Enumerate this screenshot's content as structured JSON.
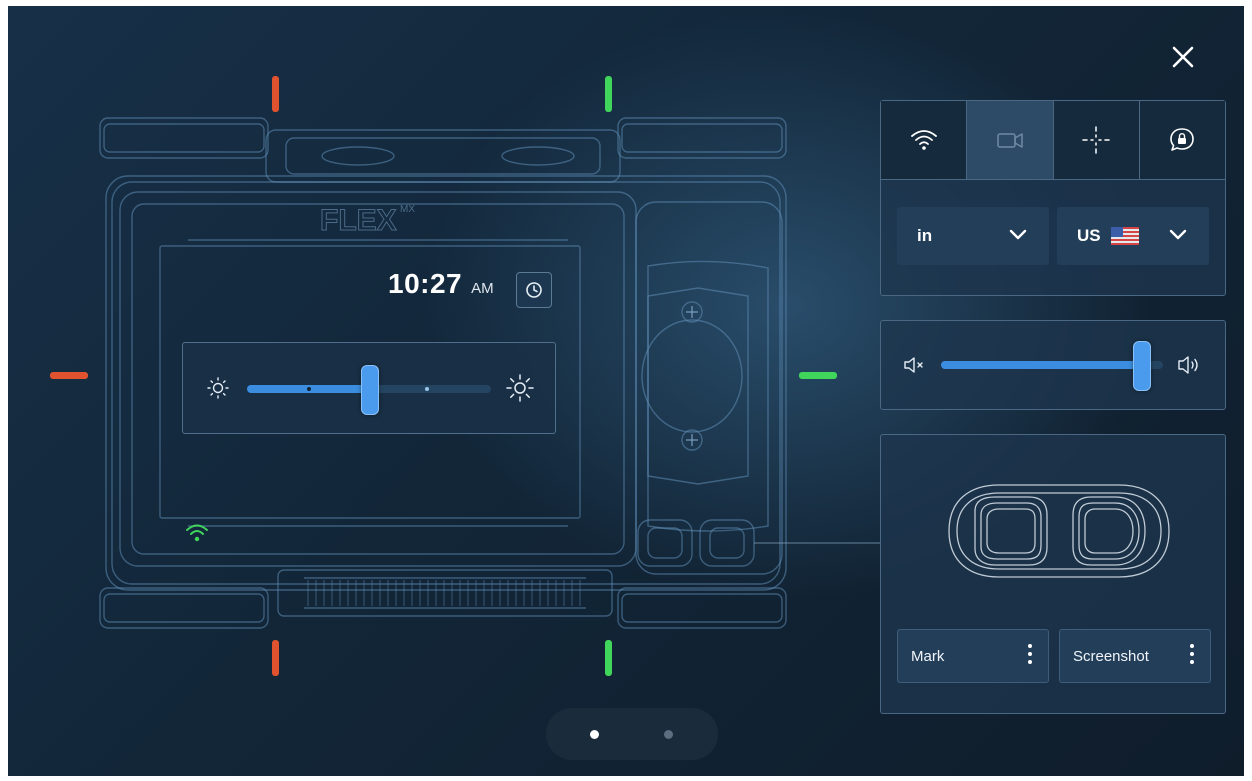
{
  "device": {
    "brand_logo": "FLEX",
    "brand_logo_suffix": "MX",
    "clock": {
      "time": "10:27",
      "ampm": "AM"
    },
    "brightness": {
      "level": 0.5
    },
    "wifi_status": "connected"
  },
  "markers": {
    "red": "#e0532e",
    "green": "#3fd65b"
  },
  "panel": {
    "tabs": [
      {
        "name": "wifi",
        "icon": "wifi-icon",
        "selected": false
      },
      {
        "name": "camera",
        "icon": "camera-icon",
        "selected": true
      },
      {
        "name": "crosshair",
        "icon": "crosshair-icon",
        "selected": false
      },
      {
        "name": "chat-lock",
        "icon": "chat-lock-icon",
        "selected": false
      }
    ],
    "units_select": {
      "value": "in"
    },
    "region_select": {
      "value": "US",
      "flag": "us-flag-icon"
    },
    "volume": {
      "level": 0.9
    },
    "buttons": {
      "mark_label": "Mark",
      "screenshot_label": "Screenshot"
    }
  },
  "pager": {
    "pages": 2,
    "current": 1
  },
  "colors": {
    "accent": "#3b8de0",
    "background": "#132a3f",
    "text": "#ffffff"
  }
}
